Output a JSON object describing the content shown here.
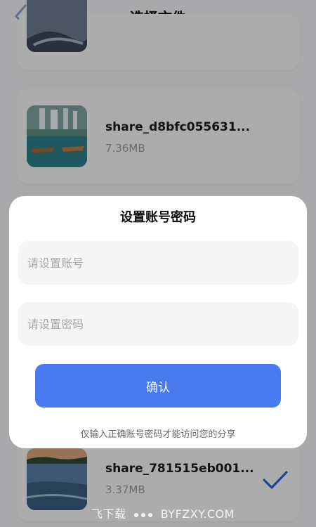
{
  "header": {
    "title": "选择文件"
  },
  "files": [
    {
      "name": "share_d8bfc055631...",
      "size": "7.36MB",
      "thumb": "waterfall-photo",
      "selected": false
    },
    {
      "name": "share_781515eb001...",
      "size": "3.37MB",
      "thumb": "beach-sunset-photo",
      "selected": true
    }
  ],
  "modal": {
    "title": "设置账号密码",
    "account_placeholder": "请设置账号",
    "password_placeholder": "请设置密码",
    "confirm_label": "确认",
    "hint": "仅输入正确账号密码才能访问您的分享"
  },
  "watermark": {
    "left": "飞下载",
    "right": "BYFZXY.COM"
  },
  "colors": {
    "accent": "#4a7af0",
    "check": "#2e5fd6"
  }
}
